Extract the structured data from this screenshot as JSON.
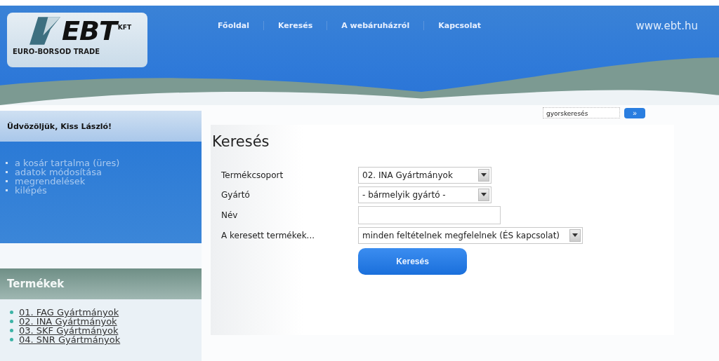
{
  "header": {
    "logo_letters": "EBT",
    "logo_suffix": "KFT",
    "logo_company": "EURO-BORSOD TRADE",
    "nav": [
      {
        "label": "Főoldal"
      },
      {
        "label": "Keresés"
      },
      {
        "label": "A webáruházról"
      },
      {
        "label": "Kapcsolat"
      }
    ],
    "site_url": "www.ebt.hu"
  },
  "quick_search": {
    "value": "gyorskeresés",
    "button": "»"
  },
  "sidebar": {
    "welcome": "Üdvözöljük, Kiss László!",
    "user_menu": [
      {
        "label": "a kosár tartalma (üres)"
      },
      {
        "label": "adatok módosítása"
      },
      {
        "label": "megrendelések"
      },
      {
        "label": "kilépés"
      }
    ],
    "products_title": "Termékek",
    "products": [
      {
        "label": "01. FAG Gyártmányok"
      },
      {
        "label": "02. INA Gyártmányok"
      },
      {
        "label": "03. SKF Gyártmányok"
      },
      {
        "label": "04. SNR Gyártmányok"
      }
    ]
  },
  "search_form": {
    "title": "Keresés",
    "fields": [
      {
        "label": "Termékcsoport",
        "kind": "select",
        "value": "02. INA Gyártmányok"
      },
      {
        "label": "Gyártó",
        "kind": "select",
        "value": "- bármelyik gyártó -"
      },
      {
        "label": "Név",
        "kind": "text"
      },
      {
        "label": "A keresett termékek...",
        "kind": "select",
        "value": "minden feltételnek megfelelnek (ÉS kapcsolat)"
      }
    ],
    "submit": "Keresés"
  }
}
